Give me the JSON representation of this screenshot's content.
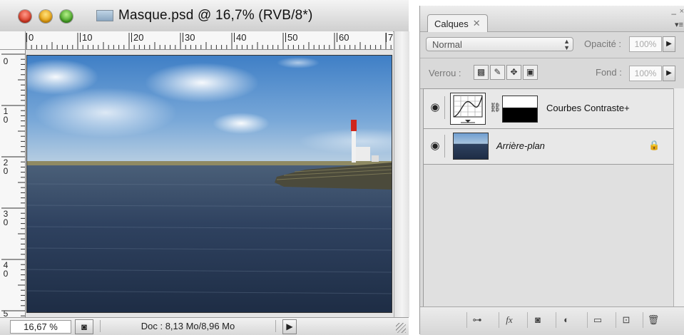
{
  "document_window": {
    "title": "Masque.psd @ 16,7% (RVB/8*)",
    "ruler_h_labels": [
      "0",
      "10",
      "20",
      "30",
      "40",
      "50",
      "60",
      "7"
    ],
    "ruler_v_labels": [
      "0",
      "1\n0",
      "2\n0",
      "3\n0",
      "4\n0",
      "5"
    ],
    "status": {
      "zoom": "16,67 %",
      "doc_info": "Doc : 8,13 Mo/8,96 Mo",
      "nav_arrow": "▶"
    }
  },
  "layers_panel": {
    "tab_label": "Calques",
    "tab_close": "✕",
    "blend_mode": "Normal",
    "opacity_label": "Opacité :",
    "opacity_value": "100%",
    "lock_label": "Verrou :",
    "fill_label": "Fond :",
    "fill_value": "100%",
    "layers": [
      {
        "name": "Courbes Contraste+",
        "visible_icon": "eye-icon"
      },
      {
        "name": "Arrière-plan",
        "visible_icon": "eye-icon",
        "locked": true
      }
    ],
    "bottom_buttons": [
      "link-layers",
      "fx",
      "mask",
      "adjustment",
      "group",
      "new-layer",
      "trash"
    ],
    "fx_label": "fx"
  }
}
